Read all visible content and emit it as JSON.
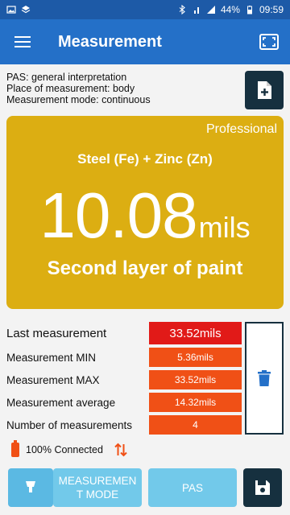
{
  "status_bar": {
    "icons_left": [
      "image-icon",
      "layers-icon"
    ],
    "icons_right": [
      "bluetooth-icon",
      "4g-signal-icon",
      "signal-icon"
    ],
    "battery": "44%",
    "time": "09:59"
  },
  "app_bar": {
    "title": "Measurement",
    "menu_icon": "menu-icon",
    "action_icon": "fullscreen-icon"
  },
  "info": {
    "pas": "PAS: general interpretation",
    "place": "Place of measurement: body",
    "mode": "Measurement mode: continuous"
  },
  "reading": {
    "badge": "Professional",
    "material": "Steel (Fe) + Zinc (Zn)",
    "value": "10.08",
    "unit": "mils",
    "layer": "Second layer of paint"
  },
  "stats": [
    {
      "label": "Last measurement",
      "value": "33.52mils"
    },
    {
      "label": "Measurement MIN",
      "value": "5.36mils"
    },
    {
      "label": "Measurement MAX",
      "value": "33.52mils"
    },
    {
      "label": "Measurement average",
      "value": "14.32mils"
    },
    {
      "label": "Number of measurements",
      "value": "4"
    }
  ],
  "connection": {
    "status": "100% Connected"
  },
  "buttons": {
    "mode": "MEASUREMENT MODE",
    "pas": "PAS"
  },
  "colors": {
    "app_bar": "#2470c8",
    "status_bar": "#1d5aa7",
    "reading_card": "#dcae12",
    "last_value": "#e11a18",
    "stat_value": "#f05016",
    "dark_button": "#16303f",
    "light_button": "#72c9ea"
  }
}
